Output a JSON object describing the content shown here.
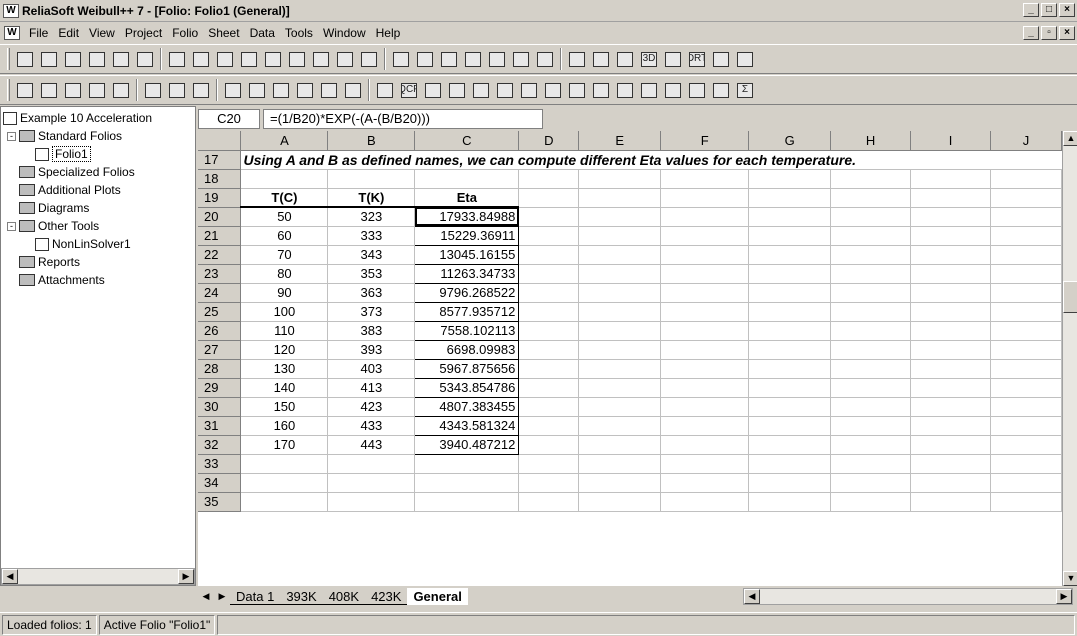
{
  "window": {
    "title": "ReliaSoft Weibull++ 7 - [Folio: Folio1 (General)]",
    "app_icon": "W"
  },
  "menu": [
    "File",
    "Edit",
    "View",
    "Project",
    "Folio",
    "Sheet",
    "Data",
    "Tools",
    "Window",
    "Help"
  ],
  "toolbar1": {
    "icons": [
      "new-icon",
      "open-icon",
      "save-icon",
      "print-icon",
      "print-preview-icon",
      "export-icon",
      "spell-check-icon",
      "check-icon",
      "cut-icon",
      "copy-icon",
      "paste-icon",
      "undo-icon",
      "find-icon",
      "replace-icon",
      "table-icon",
      "plot-icon",
      "calculator-icon",
      "transfer-icon",
      "chart-icon",
      "grid-icon",
      "border-icon",
      "hatch-icon",
      "settings-icon",
      "add-plot-icon",
      "picture-icon",
      "3d-icon",
      "line-icon",
      "drt-icon",
      "sigma-percent-icon",
      "help-icon"
    ],
    "glyphs": {
      "3d": "3D",
      "drt": "DRT"
    }
  },
  "toolbar2": {
    "icons": [
      "font-color-icon",
      "fill-color-icon",
      "align-left-icon",
      "align-center-icon",
      "align-right-icon",
      "merge-icon",
      "decimals-icon",
      "decrease-decimals-icon",
      "insert-table-icon",
      "insert-row-icon",
      "insert-column-icon",
      "delete-icon",
      "panel-icon",
      "window-icon",
      "chart-icon",
      "qcp-icon",
      "tool-icon",
      "diamond-icon",
      "filter-icon",
      "calc-icon",
      "grid-icon",
      "image-icon",
      "sheet-icon",
      "insert-icon",
      "function-icon",
      "library-icon",
      "edit-icon",
      "sort-ascending-icon",
      "sort-descending-icon",
      "sum-icon"
    ],
    "glyphs": {
      "qcp": "QCP",
      "sum": "Σ"
    }
  },
  "tree": {
    "root": "Example 10 Acceleration",
    "items": [
      {
        "label": "Standard Folios",
        "level": 1,
        "expand": "-"
      },
      {
        "label": "Folio1",
        "level": 2,
        "selected": true
      },
      {
        "label": "Specialized Folios",
        "level": 1
      },
      {
        "label": "Additional Plots",
        "level": 1
      },
      {
        "label": "Diagrams",
        "level": 1
      },
      {
        "label": "Other Tools",
        "level": 1,
        "expand": "-"
      },
      {
        "label": "NonLinSolver1",
        "level": 2
      },
      {
        "label": "Reports",
        "level": 1
      },
      {
        "label": "Attachments",
        "level": 1
      }
    ]
  },
  "formula_bar": {
    "cell_ref": "C20",
    "formula": "=(1/B20)*EXP(-(A-(B/B20)))"
  },
  "sheet": {
    "columns": [
      "A",
      "B",
      "C",
      "D",
      "E",
      "F",
      "G",
      "H",
      "I",
      "J"
    ],
    "note_row": 17,
    "note": "Using A and B as defined names, we can compute different Eta values for each temperature.",
    "header_row": 19,
    "headers": [
      "T(C)",
      "T(K)",
      "Eta"
    ],
    "rows": [
      {
        "row": 20,
        "tc": "50",
        "tk": "323",
        "eta": "17933.84988"
      },
      {
        "row": 21,
        "tc": "60",
        "tk": "333",
        "eta": "15229.36911"
      },
      {
        "row": 22,
        "tc": "70",
        "tk": "343",
        "eta": "13045.16155"
      },
      {
        "row": 23,
        "tc": "80",
        "tk": "353",
        "eta": "11263.34733"
      },
      {
        "row": 24,
        "tc": "90",
        "tk": "363",
        "eta": "9796.268522"
      },
      {
        "row": 25,
        "tc": "100",
        "tk": "373",
        "eta": "8577.935712"
      },
      {
        "row": 26,
        "tc": "110",
        "tk": "383",
        "eta": "7558.102113"
      },
      {
        "row": 27,
        "tc": "120",
        "tk": "393",
        "eta": "6698.09983"
      },
      {
        "row": 28,
        "tc": "130",
        "tk": "403",
        "eta": "5967.875656"
      },
      {
        "row": 29,
        "tc": "140",
        "tk": "413",
        "eta": "5343.854786"
      },
      {
        "row": 30,
        "tc": "150",
        "tk": "423",
        "eta": "4807.383455"
      },
      {
        "row": 31,
        "tc": "160",
        "tk": "433",
        "eta": "4343.581324"
      },
      {
        "row": 32,
        "tc": "170",
        "tk": "443",
        "eta": "3940.487212"
      }
    ],
    "empty_rows": [
      18,
      33,
      34,
      35
    ]
  },
  "sheet_tabs": [
    {
      "label": "Data 1",
      "active": false
    },
    {
      "label": "393K",
      "active": false
    },
    {
      "label": "408K",
      "active": false
    },
    {
      "label": "423K",
      "active": false
    },
    {
      "label": "General",
      "active": true
    }
  ],
  "status": {
    "loaded": "Loaded folios: 1",
    "active": "Active Folio \"Folio1\""
  }
}
